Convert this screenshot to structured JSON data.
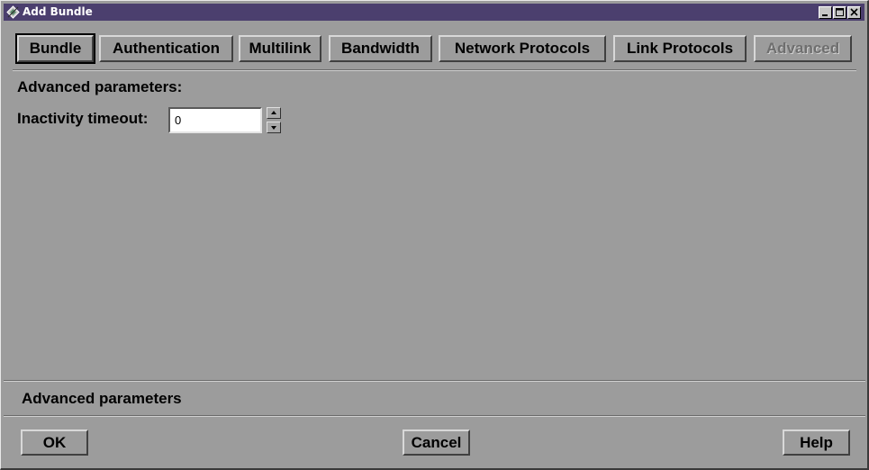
{
  "window": {
    "title": "Add Bundle",
    "title_icon": "app-icon",
    "controls": [
      "minimize-icon",
      "maximize-icon",
      "close-icon"
    ],
    "title_bar_color": "#4b3f6e"
  },
  "tabs": [
    {
      "label": "Bundle",
      "state": "focused"
    },
    {
      "label": "Authentication",
      "state": "normal"
    },
    {
      "label": "Multilink",
      "state": "normal"
    },
    {
      "label": "Bandwidth",
      "state": "normal"
    },
    {
      "label": "Network Protocols",
      "state": "normal"
    },
    {
      "label": "Link Protocols",
      "state": "normal"
    },
    {
      "label": "Advanced",
      "state": "disabled"
    }
  ],
  "main": {
    "section_title": "Advanced parameters:",
    "inactivity_timeout": {
      "label": "Inactivity timeout:",
      "value": "0"
    }
  },
  "status_bar": {
    "text": "Advanced parameters"
  },
  "footer": {
    "ok_label": "OK",
    "cancel_label": "Cancel",
    "help_label": "Help"
  }
}
